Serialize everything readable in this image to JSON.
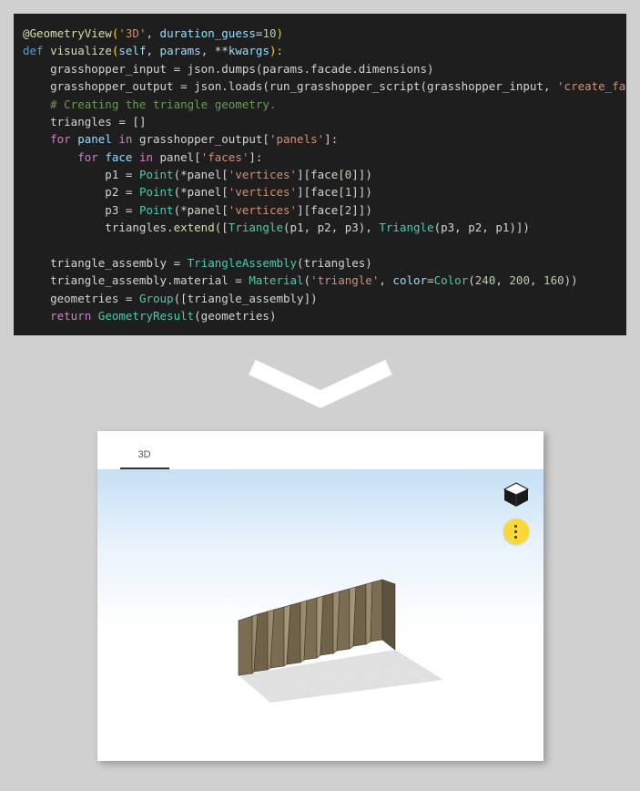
{
  "code": {
    "l1_a": "@GeometryView",
    "l1_b": "(",
    "l1_c": "'3D'",
    "l1_d": ", ",
    "l1_e": "duration_guess",
    "l1_f": "=",
    "l1_g": "10",
    "l1_h": ")",
    "l2_a": "def ",
    "l2_b": "visualize",
    "l2_c": "(",
    "l2_d": "self",
    "l2_e": ", ",
    "l2_f": "params",
    "l2_g": ", **",
    "l2_h": "kwargs",
    "l2_i": "):",
    "l3_a": "    grasshopper_input ",
    "l3_b": "=",
    "l3_c": " json.dumps(params.facade.dimensions)",
    "l4_a": "    grasshopper_output ",
    "l4_b": "=",
    "l4_c": " json.loads(run_grasshopper_script(grasshopper_input, ",
    "l4_d": "'create_facade'",
    "l4_e": "))",
    "l5": "    # Creating the triangle geometry.",
    "l6_a": "    triangles ",
    "l6_b": "=",
    "l6_c": " []",
    "l7_a": "    for ",
    "l7_b": "panel ",
    "l7_c": "in ",
    "l7_d": "grasshopper_output[",
    "l7_e": "'panels'",
    "l7_f": "]:",
    "l8_a": "        for ",
    "l8_b": "face ",
    "l8_c": "in ",
    "l8_d": "panel[",
    "l8_e": "'faces'",
    "l8_f": "]:",
    "l9_a": "            p1 ",
    "l9_b": "=",
    "l9_c": " Point",
    "l9_d": "(*panel[",
    "l9_e": "'vertices'",
    "l9_f": "][face[",
    "l9_g": "0",
    "l9_h": "]])",
    "l10_a": "            p2 ",
    "l10_b": "=",
    "l10_c": " Point",
    "l10_d": "(*panel[",
    "l10_e": "'vertices'",
    "l10_f": "][face[",
    "l10_g": "1",
    "l10_h": "]])",
    "l11_a": "            p3 ",
    "l11_b": "=",
    "l11_c": " Point",
    "l11_d": "(*panel[",
    "l11_e": "'vertices'",
    "l11_f": "][face[",
    "l11_g": "2",
    "l11_h": "]])",
    "l12_a": "            triangles.",
    "l12_b": "extend",
    "l12_c": "([",
    "l12_d": "Triangle",
    "l12_e": "(p1, p2, p3), ",
    "l12_f": "Triangle",
    "l12_g": "(p3, p2, p1)])",
    "l13": "",
    "l14_a": "    triangle_assembly ",
    "l14_b": "=",
    "l14_c": " TriangleAssembly",
    "l14_d": "(triangles)",
    "l15_a": "    triangle_assembly.material ",
    "l15_b": "=",
    "l15_c": " Material",
    "l15_d": "(",
    "l15_e": "'triangle'",
    "l15_f": ", ",
    "l15_g": "color",
    "l15_h": "=",
    "l15_i": "Color",
    "l15_j": "(",
    "l15_k": "240",
    "l15_l": ", ",
    "l15_m": "200",
    "l15_n": ", ",
    "l15_o": "160",
    "l15_p": "))",
    "l16_a": "    geometries ",
    "l16_b": "=",
    "l16_c": " Group",
    "l16_d": "([triangle_assembly])",
    "l17_a": "    return ",
    "l17_b": "GeometryResult",
    "l17_c": "(geometries)"
  },
  "viewer": {
    "tab_label": "3D"
  }
}
